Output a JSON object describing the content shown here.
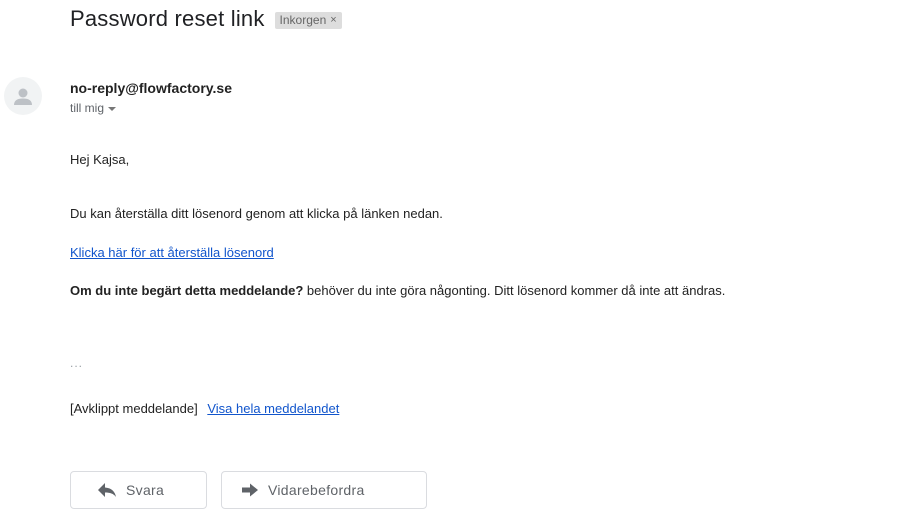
{
  "email": {
    "subject": "Password reset link",
    "label_chip": "Inkorgen",
    "label_remove": "×",
    "sender": "no-reply@flowfactory.se",
    "recipient": "till mig",
    "greeting": "Hej Kajsa,",
    "line1": "Du kan återställa ditt lösenord genom att klicka på länken nedan.",
    "reset_link": "Klicka här för att återställa lösenord",
    "notice_bold": "Om du inte begärt detta meddelande?",
    "notice_rest": " behöver du inte göra någonting. Ditt lösenord kommer då inte att ändras.",
    "ellipsis": "...",
    "clipped_text": "[Avklippt meddelande]",
    "view_full_link": "Visa hela meddelandet"
  },
  "actions": {
    "reply_label": "Svara",
    "forward_label": "Vidarebefordra"
  },
  "icons": {
    "avatar": "default-avatar-icon",
    "reply": "reply-arrow-icon",
    "forward": "forward-arrow-icon",
    "recipient_dropdown": "caret-down-icon"
  },
  "colors": {
    "link": "#1155cc",
    "chip_bg": "#dddddd",
    "muted_text": "#5f6368"
  }
}
